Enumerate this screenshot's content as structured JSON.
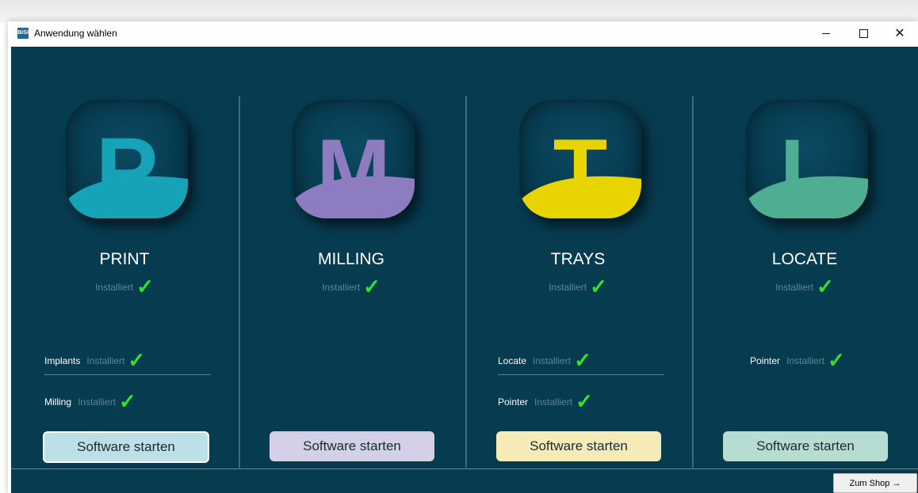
{
  "window": {
    "icon_text": "BiSi",
    "title": "Anwendung wählen",
    "close_glyph": "✕"
  },
  "status_installed": "Installiert",
  "check_glyph": "✓",
  "apps": [
    {
      "name": "PRINT",
      "letter": "P",
      "color": "#16a3b8",
      "button_color": "#bde0e7",
      "button_label": "Software starten",
      "modules": [
        {
          "name": "Implants",
          "status": "Installiert"
        },
        {
          "name": "Milling",
          "status": "Installiert"
        }
      ]
    },
    {
      "name": "MILLING",
      "letter": "M",
      "color": "#8d7dc0",
      "button_color": "#d3d0e8",
      "button_label": "Software starten",
      "modules": []
    },
    {
      "name": "TRAYS",
      "letter": "T",
      "color": "#e8d400",
      "button_color": "#f5ebb7",
      "button_label": "Software starten",
      "modules": [
        {
          "name": "Locate",
          "status": "Installiert"
        },
        {
          "name": "Pointer",
          "status": "Installiert"
        }
      ]
    },
    {
      "name": "LOCATE",
      "letter": "L",
      "color": "#4fae91",
      "button_color": "#b7ddd3",
      "button_label": "Software starten",
      "modules": [
        {
          "name": "Pointer",
          "status": "Installiert"
        }
      ]
    }
  ],
  "shop_button": "Zum Shop →"
}
